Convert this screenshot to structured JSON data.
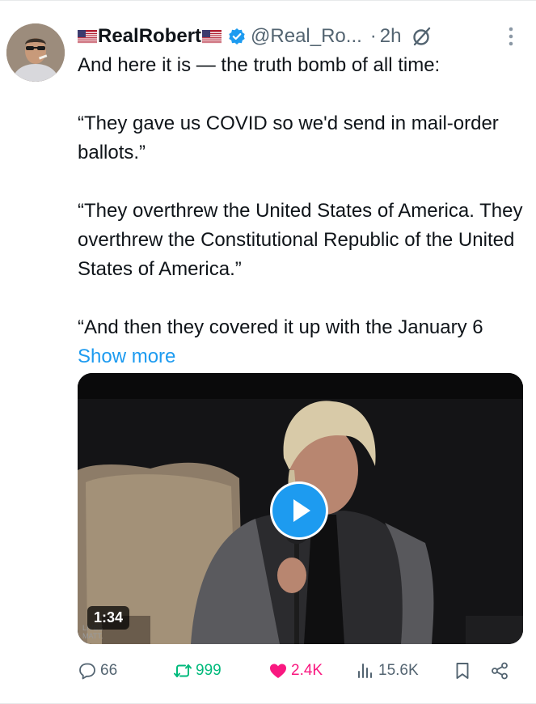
{
  "tweet": {
    "display_name": "RealRobert",
    "name_flags": [
      "flag-icon",
      "flag-icon"
    ],
    "verified": true,
    "handle": "@Real_Ro...",
    "separator": "·",
    "time": "2h",
    "text": {
      "intro": "And here it is — the truth bomb of all time:",
      "quote1": "“They gave us COVID so we'd send in mail-order ballots.”",
      "quote2": "“They overthrew the United States of America. They overthrew the Constitutional Republic of the United States of America.”",
      "quote3": "“And then they covered it up with the January 6",
      "show_more": "Show more"
    },
    "media": {
      "type": "video",
      "duration": "1:34"
    },
    "actions": {
      "replies": "66",
      "reposts": "999",
      "likes": "2.4K",
      "views": "15.6K"
    }
  },
  "colors": {
    "accent": "#1d9bf0",
    "repost": "#00ba7c",
    "like": "#f91880",
    "secondary_text": "#536471"
  },
  "icons": {
    "more": "more-vertical-icon",
    "note": "slashed-circle-icon",
    "reply": "reply-icon",
    "repost": "repost-icon",
    "like": "heart-icon",
    "views": "views-icon",
    "bookmark": "bookmark-icon",
    "share": "share-icon"
  }
}
